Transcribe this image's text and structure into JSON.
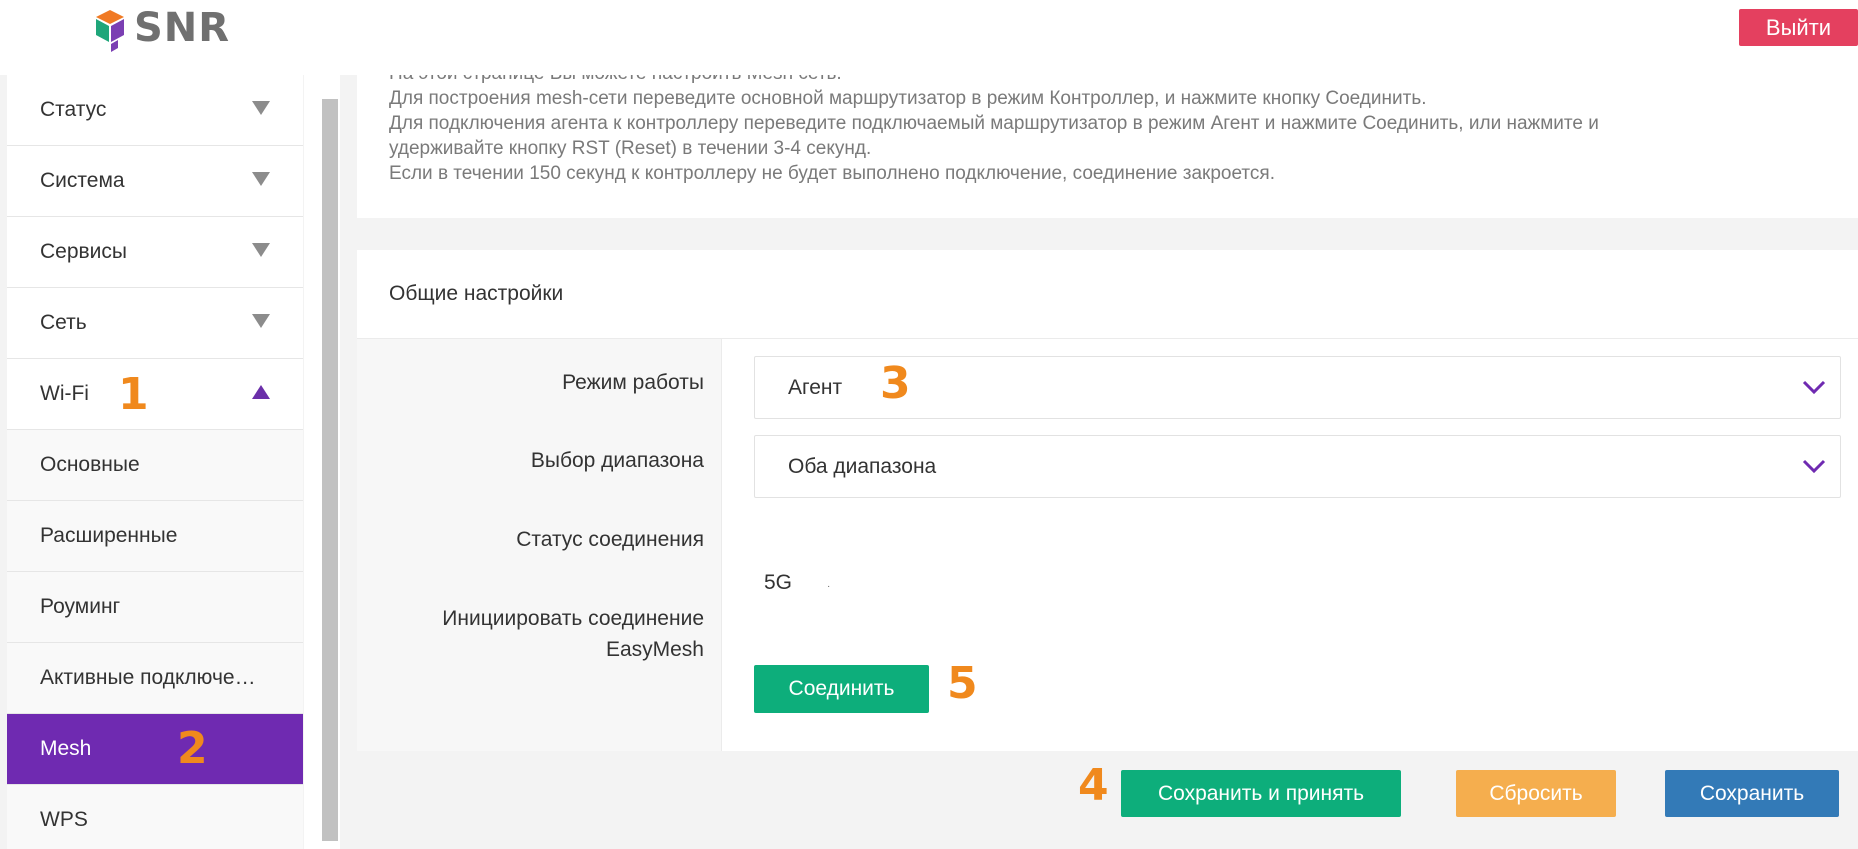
{
  "header": {
    "logo_text": "SNR",
    "logout_label": "Выйти"
  },
  "sidebar": {
    "menu": [
      {
        "label": "Статус",
        "expanded": false
      },
      {
        "label": "Система",
        "expanded": false
      },
      {
        "label": "Сервисы",
        "expanded": false
      },
      {
        "label": "Сеть",
        "expanded": false
      },
      {
        "label": "Wi-Fi",
        "expanded": true
      }
    ],
    "wifi_submenu": [
      {
        "label": "Основные",
        "active": false
      },
      {
        "label": "Расширенные",
        "active": false
      },
      {
        "label": "Роуминг",
        "active": false
      },
      {
        "label": "Активные подключе…",
        "active": false
      },
      {
        "label": "Mesh",
        "active": true
      },
      {
        "label": "WPS",
        "active": false
      }
    ]
  },
  "info": {
    "lines": [
      "На этой странице Вы можете настроить Mesh сеть.",
      "Для построения mesh-сети переведите основной маршрутизатор в режим Контроллер, и нажмите кнопку Соединить.",
      "Для подключения агента к контроллеру переведите подключаемый маршрутизатор в режим Агент и нажмите Соединить, или нажмите и",
      "удерживайте кнопку RST (Reset) в течении 3-4 секунд.",
      "Если в течении 150 секунд к контроллеру не будет выполнено подключение, соединение закроется."
    ]
  },
  "general": {
    "title": "Общие настройки",
    "mode_label": "Режим работы",
    "mode_value": "Агент",
    "band_label": "Выбор диапазона",
    "band_value": "Оба диапазона",
    "status_label": "Статус соединения",
    "status_value": "5G",
    "status_dot": "·",
    "initiate_label_line1": "Инициировать соединение",
    "initiate_label_line2": "EasyMesh",
    "connect_label": "Соединить"
  },
  "actions": {
    "apply_label": "Сохранить и принять",
    "reset_label": "Сбросить",
    "save_label": "Сохранить"
  },
  "markers": {
    "m1": "1",
    "m2": "2",
    "m3": "3",
    "m4": "4",
    "m5": "5"
  },
  "colors": {
    "accent_purple": "#6f2ab1",
    "green": "#0dae7b",
    "orange": "#f5ae4e",
    "blue": "#337ab7",
    "logout_red": "#e4405f",
    "marker_orange": "#f0891d"
  }
}
